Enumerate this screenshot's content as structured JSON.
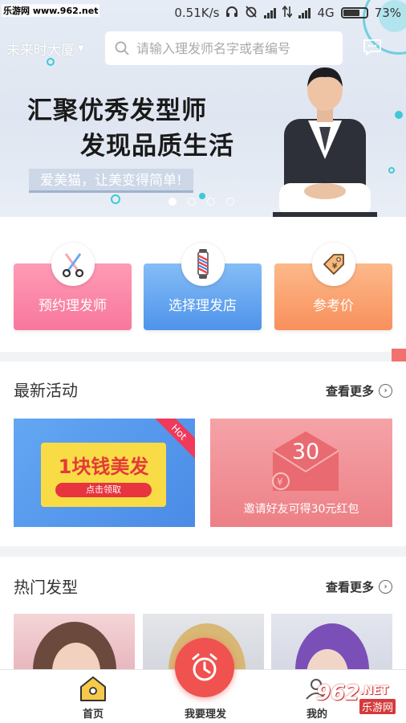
{
  "watermark": {
    "site": "乐游网 www.962.net",
    "corner_number": "962",
    "corner_suffix": ".NET",
    "corner_cn": "乐游网"
  },
  "status_bar": {
    "speed": "0.51K/s",
    "network": "4G",
    "battery": "73%",
    "battery_level": 0.73
  },
  "header": {
    "city": "未来时大厦",
    "search_placeholder": "请输入理发师名字或者编号"
  },
  "banner": {
    "slogan_line1": "汇聚优秀发型师",
    "slogan_line2": "发现品质生活",
    "tagline": "爱美猫，让美变得简单!",
    "slide_count": 4,
    "active_slide": 1
  },
  "features": [
    {
      "label": "预约理发师",
      "icon": "scissors-comb-icon"
    },
    {
      "label": "选择理发店",
      "icon": "barber-pole-icon"
    },
    {
      "label": "参考价",
      "icon": "price-tag-icon"
    }
  ],
  "latest_activity": {
    "title": "最新活动",
    "more": "查看更多",
    "card1": {
      "title": "1块钱美发",
      "button": "点击领取",
      "badge": "Hot"
    },
    "card2": {
      "amount": "30",
      "text": "邀请好友可得30元红包"
    }
  },
  "hot_styles": {
    "title": "热门发型",
    "more": "查看更多"
  },
  "bottom_nav": {
    "home": "首页",
    "book": "我要理发",
    "mine": "我的"
  },
  "colors": {
    "accent_red": "#f0524f",
    "pink": "#f8779c",
    "blue": "#4f93eb",
    "orange": "#f8905c"
  }
}
